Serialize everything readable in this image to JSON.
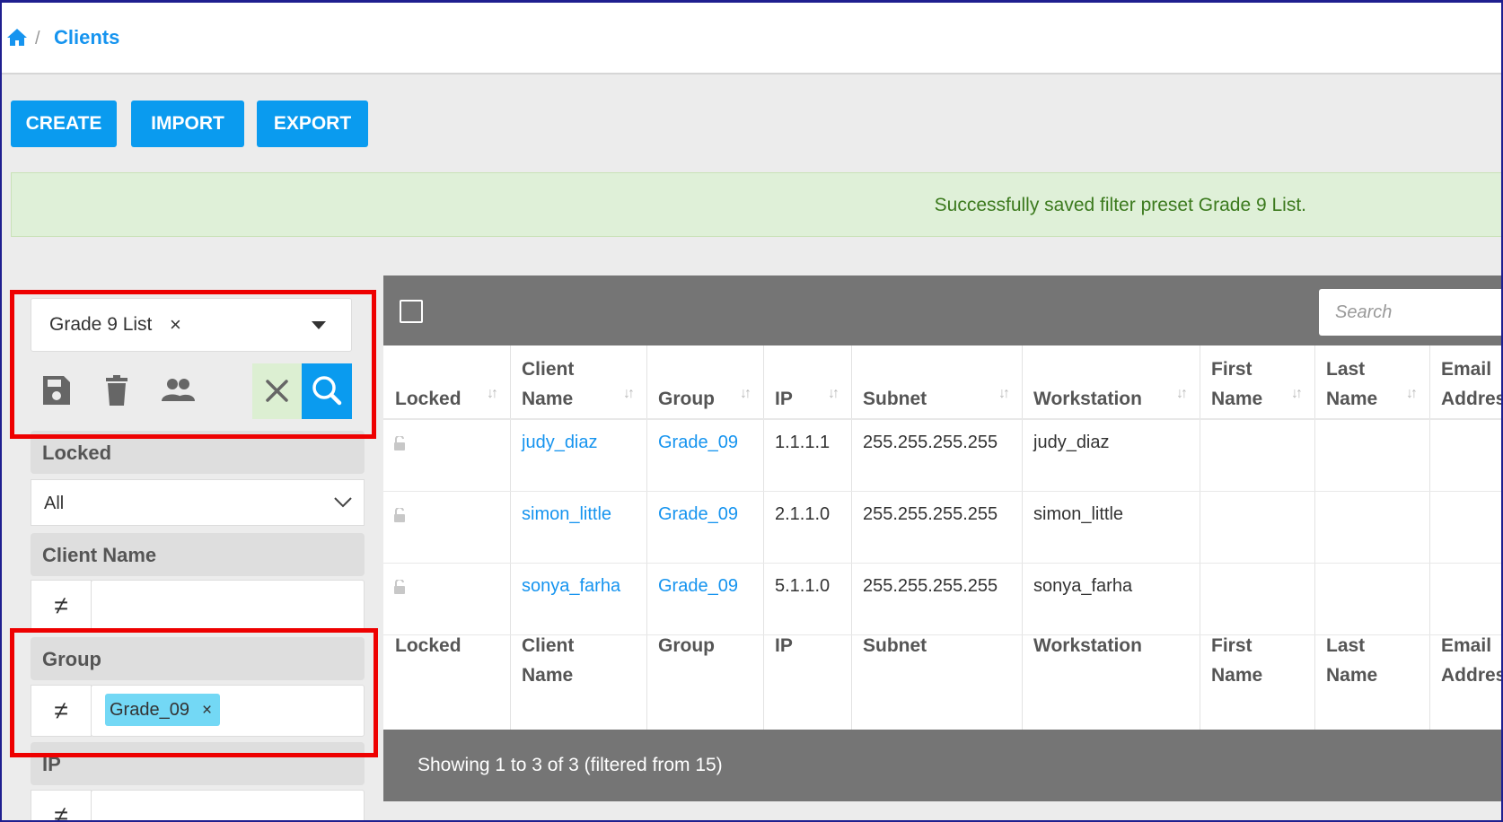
{
  "breadcrumb": {
    "current": "Clients"
  },
  "toolbar": {
    "create": "CREATE",
    "import": "IMPORT",
    "export": "EXPORT"
  },
  "alert": {
    "message": "Successfully saved filter preset Grade 9 List."
  },
  "preset": {
    "selected": "Grade 9 List",
    "remove": "×"
  },
  "filters": {
    "locked": {
      "label": "Locked",
      "value": "All"
    },
    "client_name": {
      "label": "Client Name",
      "operator": "≠",
      "value": ""
    },
    "group": {
      "label": "Group",
      "operator": "≠",
      "tag": "Grade_09",
      "tag_remove": "×"
    },
    "ip": {
      "label": "IP",
      "operator": "≠",
      "value": ""
    }
  },
  "table": {
    "search_placeholder": "Search",
    "headers": [
      {
        "line1": "",
        "line2": "Locked"
      },
      {
        "line1": "Client",
        "line2": "Name"
      },
      {
        "line1": "",
        "line2": "Group"
      },
      {
        "line1": "",
        "line2": "IP"
      },
      {
        "line1": "",
        "line2": "Subnet"
      },
      {
        "line1": "",
        "line2": "Workstation"
      },
      {
        "line1": "First",
        "line2": "Name"
      },
      {
        "line1": "Last",
        "line2": "Name"
      },
      {
        "line1": "Email",
        "line2": "Address"
      }
    ],
    "rows": [
      {
        "client_name": "judy_diaz",
        "group": "Grade_09",
        "ip": "1.1.1.1",
        "subnet": "255.255.255.255",
        "workstation": "judy_diaz"
      },
      {
        "client_name": "simon_little",
        "group": "Grade_09",
        "ip": "2.1.1.0",
        "subnet": "255.255.255.255",
        "workstation": "simon_little"
      },
      {
        "client_name": "sonya_farha",
        "group": "Grade_09",
        "ip": "5.1.1.0",
        "subnet": "255.255.255.255",
        "workstation": "sonya_farha"
      }
    ],
    "footer": [
      {
        "line1": "Locked",
        "line2": ""
      },
      {
        "line1": "Client",
        "line2": "Name"
      },
      {
        "line1": "Group",
        "line2": ""
      },
      {
        "line1": "IP",
        "line2": ""
      },
      {
        "line1": "Subnet",
        "line2": ""
      },
      {
        "line1": "Workstation",
        "line2": ""
      },
      {
        "line1": "First",
        "line2": "Name"
      },
      {
        "line1": "Last",
        "line2": "Name"
      },
      {
        "line1": "Email",
        "line2": "Address"
      }
    ],
    "info": "Showing 1 to 3 of 3 (filtered from 15)"
  },
  "colors": {
    "accent": "#0a9bef",
    "link": "#1694ef",
    "highlight": "#ee0000",
    "success_bg": "#dff0d8"
  },
  "icons": [
    "home-icon",
    "save-icon",
    "trash-icon",
    "users-icon",
    "clear-icon",
    "search-icon",
    "unlock-icon",
    "caret-down-icon",
    "chevron-down-icon"
  ]
}
